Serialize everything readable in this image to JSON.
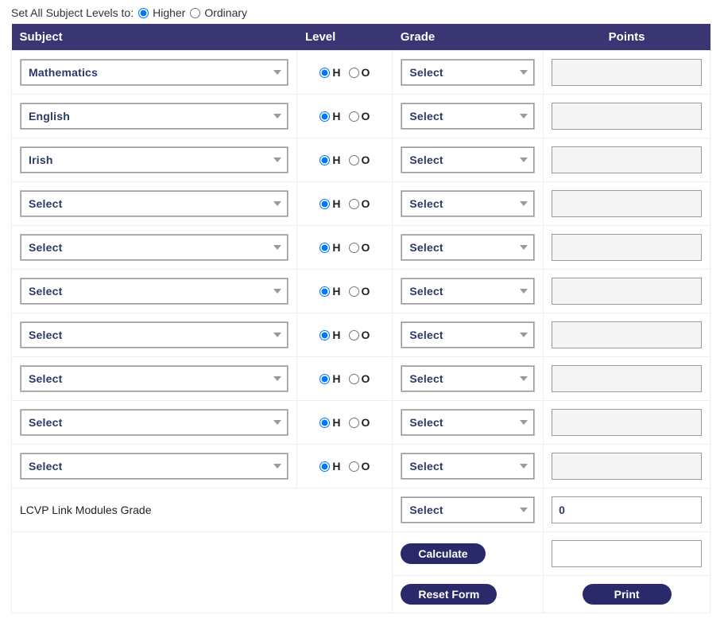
{
  "top": {
    "label": "Set All Subject Levels to:",
    "higher": "Higher",
    "ordinary": "Ordinary"
  },
  "headers": {
    "subject": "Subject",
    "level": "Level",
    "grade": "Grade",
    "points": "Points"
  },
  "level_h": "H",
  "level_o": "O",
  "rows": [
    {
      "subject": "Mathematics",
      "level": "H",
      "grade": "Select",
      "points": ""
    },
    {
      "subject": "English",
      "level": "H",
      "grade": "Select",
      "points": ""
    },
    {
      "subject": "Irish",
      "level": "H",
      "grade": "Select",
      "points": ""
    },
    {
      "subject": "Select",
      "level": "H",
      "grade": "Select",
      "points": ""
    },
    {
      "subject": "Select",
      "level": "H",
      "grade": "Select",
      "points": ""
    },
    {
      "subject": "Select",
      "level": "H",
      "grade": "Select",
      "points": ""
    },
    {
      "subject": "Select",
      "level": "H",
      "grade": "Select",
      "points": ""
    },
    {
      "subject": "Select",
      "level": "H",
      "grade": "Select",
      "points": ""
    },
    {
      "subject": "Select",
      "level": "H",
      "grade": "Select",
      "points": ""
    },
    {
      "subject": "Select",
      "level": "H",
      "grade": "Select",
      "points": ""
    }
  ],
  "lcvp": {
    "label": "LCVP Link Modules Grade",
    "grade": "Select",
    "points": "0"
  },
  "buttons": {
    "calculate": "Calculate",
    "reset": "Reset Form",
    "print": "Print"
  }
}
